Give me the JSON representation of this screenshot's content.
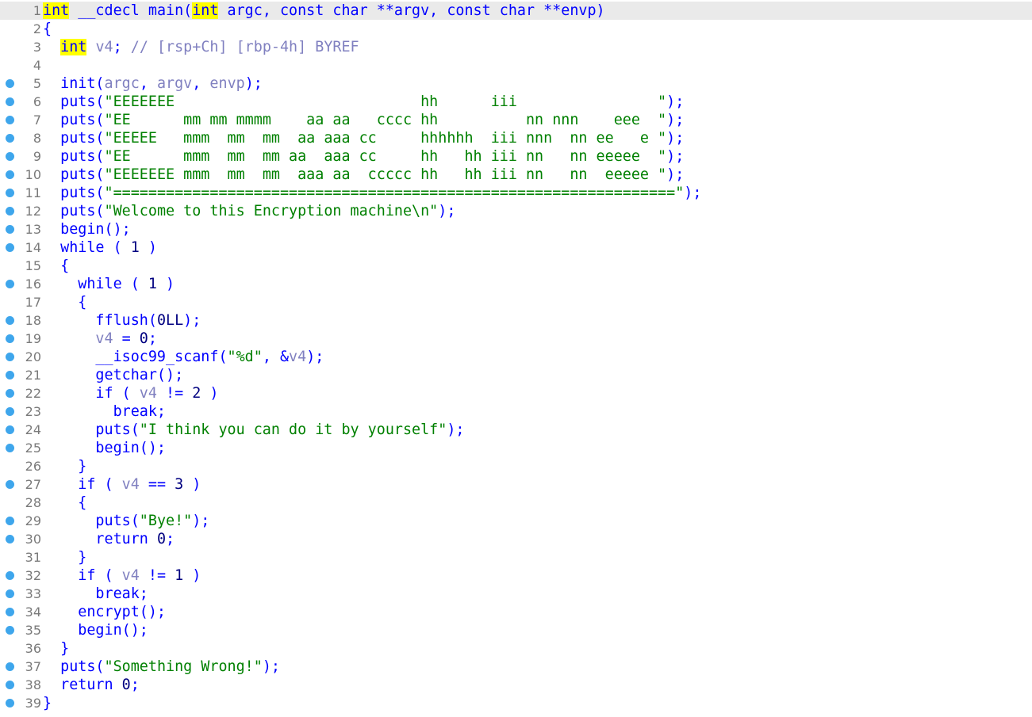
{
  "editor": {
    "title": "IDA pseudocode view",
    "lines": [
      {
        "num": "1",
        "bp": false,
        "current": true,
        "tokens": [
          {
            "t": "kwh",
            "v": "int"
          },
          {
            "t": "p",
            "v": " __cdecl main("
          },
          {
            "t": "kwh",
            "v": "int"
          },
          {
            "t": "p",
            "v": " argc, const char **argv, const char **envp)"
          }
        ]
      },
      {
        "num": "2",
        "bp": false,
        "tokens": [
          {
            "t": "p",
            "v": "{"
          }
        ]
      },
      {
        "num": "3",
        "bp": false,
        "tokens": [
          {
            "t": "p",
            "v": "  "
          },
          {
            "t": "kwh",
            "v": "int"
          },
          {
            "t": "v",
            "v": " v4"
          },
          {
            "t": "p",
            "v": "; "
          },
          {
            "t": "c",
            "v": "// [rsp+Ch] [rbp-4h] BYREF"
          }
        ]
      },
      {
        "num": "4",
        "bp": false,
        "tokens": []
      },
      {
        "num": "5",
        "bp": true,
        "tokens": [
          {
            "t": "p",
            "v": "  init("
          },
          {
            "t": "v",
            "v": "argc"
          },
          {
            "t": "p",
            "v": ", "
          },
          {
            "t": "v",
            "v": "argv"
          },
          {
            "t": "p",
            "v": ", "
          },
          {
            "t": "v",
            "v": "envp"
          },
          {
            "t": "p",
            "v": ");"
          }
        ]
      },
      {
        "num": "6",
        "bp": true,
        "tokens": [
          {
            "t": "p",
            "v": "  puts("
          },
          {
            "t": "s",
            "v": "\"EEEEEEE                            hh      iii                \""
          },
          {
            "t": "p",
            "v": ");"
          }
        ]
      },
      {
        "num": "7",
        "bp": true,
        "tokens": [
          {
            "t": "p",
            "v": "  puts("
          },
          {
            "t": "s",
            "v": "\"EE      mm mm mmmm    aa aa   cccc hh          nn nnn    eee  \""
          },
          {
            "t": "p",
            "v": ");"
          }
        ]
      },
      {
        "num": "8",
        "bp": true,
        "tokens": [
          {
            "t": "p",
            "v": "  puts("
          },
          {
            "t": "s",
            "v": "\"EEEEE   mmm  mm  mm  aa aaa cc     hhhhhh  iii nnn  nn ee   e \""
          },
          {
            "t": "p",
            "v": ");"
          }
        ]
      },
      {
        "num": "9",
        "bp": true,
        "tokens": [
          {
            "t": "p",
            "v": "  puts("
          },
          {
            "t": "s",
            "v": "\"EE      mmm  mm  mm aa  aaa cc     hh   hh iii nn   nn eeeee  \""
          },
          {
            "t": "p",
            "v": ");"
          }
        ]
      },
      {
        "num": "10",
        "bp": true,
        "tokens": [
          {
            "t": "p",
            "v": "  puts("
          },
          {
            "t": "s",
            "v": "\"EEEEEEE mmm  mm  mm  aaa aa  ccccc hh   hh iii nn   nn  eeeee \""
          },
          {
            "t": "p",
            "v": ");"
          }
        ]
      },
      {
        "num": "11",
        "bp": true,
        "tokens": [
          {
            "t": "p",
            "v": "  puts("
          },
          {
            "t": "s",
            "v": "\"================================================================\""
          },
          {
            "t": "p",
            "v": ");"
          }
        ]
      },
      {
        "num": "12",
        "bp": true,
        "tokens": [
          {
            "t": "p",
            "v": "  puts("
          },
          {
            "t": "s",
            "v": "\"Welcome to this Encryption machine\\n\""
          },
          {
            "t": "p",
            "v": ");"
          }
        ]
      },
      {
        "num": "13",
        "bp": true,
        "tokens": [
          {
            "t": "p",
            "v": "  begin();"
          }
        ]
      },
      {
        "num": "14",
        "bp": true,
        "tokens": [
          {
            "t": "p",
            "v": "  while ( "
          },
          {
            "t": "n",
            "v": "1"
          },
          {
            "t": "p",
            "v": " )"
          }
        ]
      },
      {
        "num": "15",
        "bp": false,
        "tokens": [
          {
            "t": "p",
            "v": "  {"
          }
        ]
      },
      {
        "num": "16",
        "bp": true,
        "tokens": [
          {
            "t": "p",
            "v": "    while ( "
          },
          {
            "t": "n",
            "v": "1"
          },
          {
            "t": "p",
            "v": " )"
          }
        ]
      },
      {
        "num": "17",
        "bp": false,
        "tokens": [
          {
            "t": "p",
            "v": "    {"
          }
        ]
      },
      {
        "num": "18",
        "bp": true,
        "tokens": [
          {
            "t": "p",
            "v": "      fflush("
          },
          {
            "t": "n",
            "v": "0LL"
          },
          {
            "t": "p",
            "v": ");"
          }
        ]
      },
      {
        "num": "19",
        "bp": true,
        "tokens": [
          {
            "t": "v",
            "v": "      v4"
          },
          {
            "t": "p",
            "v": " = "
          },
          {
            "t": "n",
            "v": "0"
          },
          {
            "t": "p",
            "v": ";"
          }
        ]
      },
      {
        "num": "20",
        "bp": true,
        "tokens": [
          {
            "t": "p",
            "v": "      __isoc99_scanf("
          },
          {
            "t": "s",
            "v": "\"%d\""
          },
          {
            "t": "p",
            "v": ", &"
          },
          {
            "t": "v",
            "v": "v4"
          },
          {
            "t": "p",
            "v": ");"
          }
        ]
      },
      {
        "num": "21",
        "bp": true,
        "tokens": [
          {
            "t": "p",
            "v": "      getchar();"
          }
        ]
      },
      {
        "num": "22",
        "bp": true,
        "tokens": [
          {
            "t": "p",
            "v": "      if ( "
          },
          {
            "t": "v",
            "v": "v4"
          },
          {
            "t": "p",
            "v": " != "
          },
          {
            "t": "n",
            "v": "2"
          },
          {
            "t": "p",
            "v": " )"
          }
        ]
      },
      {
        "num": "23",
        "bp": true,
        "tokens": [
          {
            "t": "p",
            "v": "        break;"
          }
        ]
      },
      {
        "num": "24",
        "bp": true,
        "tokens": [
          {
            "t": "p",
            "v": "      puts("
          },
          {
            "t": "s",
            "v": "\"I think you can do it by yourself\""
          },
          {
            "t": "p",
            "v": ");"
          }
        ]
      },
      {
        "num": "25",
        "bp": true,
        "tokens": [
          {
            "t": "p",
            "v": "      begin();"
          }
        ]
      },
      {
        "num": "26",
        "bp": false,
        "tokens": [
          {
            "t": "p",
            "v": "    }"
          }
        ]
      },
      {
        "num": "27",
        "bp": true,
        "tokens": [
          {
            "t": "p",
            "v": "    if ( "
          },
          {
            "t": "v",
            "v": "v4"
          },
          {
            "t": "p",
            "v": " == "
          },
          {
            "t": "n",
            "v": "3"
          },
          {
            "t": "p",
            "v": " )"
          }
        ]
      },
      {
        "num": "28",
        "bp": false,
        "tokens": [
          {
            "t": "p",
            "v": "    {"
          }
        ]
      },
      {
        "num": "29",
        "bp": true,
        "tokens": [
          {
            "t": "p",
            "v": "      puts("
          },
          {
            "t": "s",
            "v": "\"Bye!\""
          },
          {
            "t": "p",
            "v": ");"
          }
        ]
      },
      {
        "num": "30",
        "bp": true,
        "tokens": [
          {
            "t": "p",
            "v": "      return "
          },
          {
            "t": "n",
            "v": "0"
          },
          {
            "t": "p",
            "v": ";"
          }
        ]
      },
      {
        "num": "31",
        "bp": false,
        "tokens": [
          {
            "t": "p",
            "v": "    }"
          }
        ]
      },
      {
        "num": "32",
        "bp": true,
        "tokens": [
          {
            "t": "p",
            "v": "    if ( "
          },
          {
            "t": "v",
            "v": "v4"
          },
          {
            "t": "p",
            "v": " != "
          },
          {
            "t": "n",
            "v": "1"
          },
          {
            "t": "p",
            "v": " )"
          }
        ]
      },
      {
        "num": "33",
        "bp": true,
        "tokens": [
          {
            "t": "p",
            "v": "      break;"
          }
        ]
      },
      {
        "num": "34",
        "bp": true,
        "tokens": [
          {
            "t": "p",
            "v": "    encrypt();"
          }
        ]
      },
      {
        "num": "35",
        "bp": true,
        "tokens": [
          {
            "t": "p",
            "v": "    begin();"
          }
        ]
      },
      {
        "num": "36",
        "bp": false,
        "tokens": [
          {
            "t": "p",
            "v": "  }"
          }
        ]
      },
      {
        "num": "37",
        "bp": true,
        "tokens": [
          {
            "t": "p",
            "v": "  puts("
          },
          {
            "t": "s",
            "v": "\"Something Wrong!\""
          },
          {
            "t": "p",
            "v": ");"
          }
        ]
      },
      {
        "num": "38",
        "bp": true,
        "tokens": [
          {
            "t": "p",
            "v": "  return "
          },
          {
            "t": "n",
            "v": "0"
          },
          {
            "t": "p",
            "v": ";"
          }
        ]
      },
      {
        "num": "39",
        "bp": true,
        "tokens": [
          {
            "t": "p",
            "v": "}"
          }
        ]
      }
    ]
  },
  "colors": {
    "keyword": "#0000ff",
    "keyword_highlight": "#ffff00",
    "variable": "#8080c0",
    "string": "#008000",
    "number": "#000080",
    "line_number": "#7a7a7a",
    "breakpoint_dot": "#3ea6ec",
    "current_line_bg": "#eaeaea"
  }
}
